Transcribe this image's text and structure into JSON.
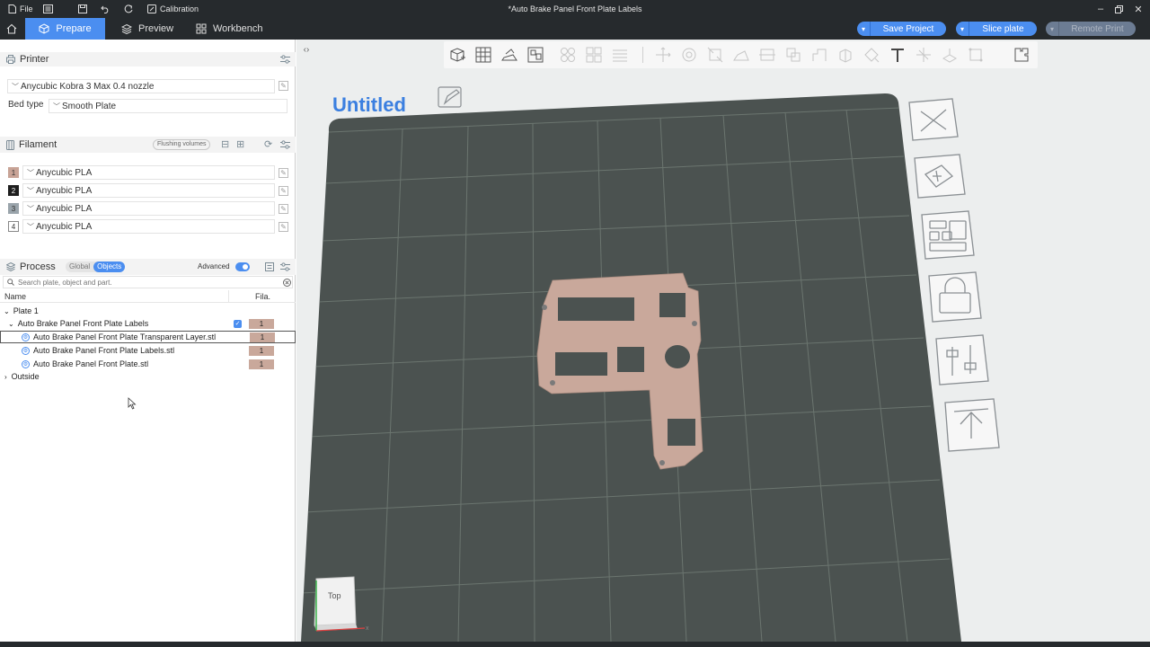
{
  "titlebar": {
    "file_label": "File",
    "calibration_label": "Calibration",
    "window_title": "*Auto Brake Panel Front Plate Labels"
  },
  "tabs": [
    {
      "label": "Prepare",
      "active": true
    },
    {
      "label": "Preview",
      "active": false
    },
    {
      "label": "Workbench",
      "active": false
    }
  ],
  "actions": {
    "save_project": "Save Project",
    "slice_plate": "Slice plate",
    "remote_print": "Remote Print"
  },
  "printer": {
    "section_title": "Printer",
    "name": "Anycubic Kobra 3 Max 0.4 nozzle",
    "bed_type_label": "Bed type",
    "bed_type_value": "Smooth Plate"
  },
  "filament": {
    "section_title": "Filament",
    "flushing_label": "Flushing volumes",
    "items": [
      {
        "num": "1",
        "name": "Anycubic PLA",
        "color": "#c8a396",
        "text_color": "#333333"
      },
      {
        "num": "2",
        "name": "Anycubic PLA",
        "color": "#1e1e1e",
        "text_color": "#ffffff"
      },
      {
        "num": "3",
        "name": "Anycubic PLA",
        "color": "#9aa4ab",
        "text_color": "#333333"
      },
      {
        "num": "4",
        "name": "Anycubic PLA",
        "color": "#ffffff",
        "text_color": "#333333"
      }
    ]
  },
  "process": {
    "section_title": "Process",
    "global_label": "Global",
    "objects_label": "Objects",
    "advanced_label": "Advanced",
    "search_placeholder": "Search plate, object and part.",
    "col_name": "Name",
    "col_fila": "Fila.",
    "plate": "Plate 1",
    "object": {
      "name": "Auto Brake Panel Front Plate Labels",
      "fila": "1"
    },
    "parts": [
      {
        "name": "Auto Brake Panel Front Plate Transparent Layer.stl",
        "fila": "1"
      },
      {
        "name": "Auto Brake Panel Front Plate Labels.stl",
        "fila": "1"
      },
      {
        "name": "Auto Brake Panel Front Plate.stl",
        "fila": "1"
      }
    ],
    "outside": "Outside"
  },
  "viewport": {
    "plate_name": "Untitled",
    "view_cube_label": "Top",
    "axis_x": "x"
  },
  "colors": {
    "accent": "#4b8ef0",
    "plate": "#4b5250",
    "part": "#c9a89b",
    "titlebar": "#262a2d"
  }
}
